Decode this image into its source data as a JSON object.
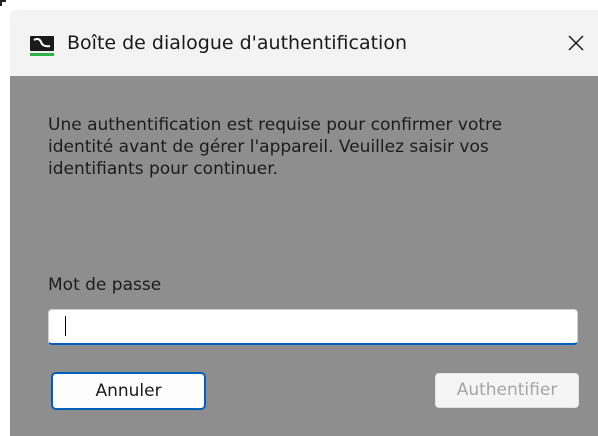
{
  "dialog": {
    "title": "Boîte de dialogue d'authentification",
    "app_icon": "sennheiser-logo-icon",
    "close_icon": "close-icon",
    "message_lines": [
      "Une authentification est requise pour confirmer votre",
      "identité avant de gérer l'appareil. Veuillez saisir vos",
      "identifiants pour continuer."
    ],
    "password_label": "Mot de passe",
    "password_value": "",
    "cancel_label": "Annuler",
    "authenticate_label": "Authentifier",
    "authenticate_enabled": false
  },
  "colors": {
    "titlebar_bg": "#f3f3f3",
    "body_bg": "#8e8e8e",
    "accent": "#005fb8",
    "logo_green": "#2db34a",
    "disabled_text": "#a5a5a5"
  }
}
